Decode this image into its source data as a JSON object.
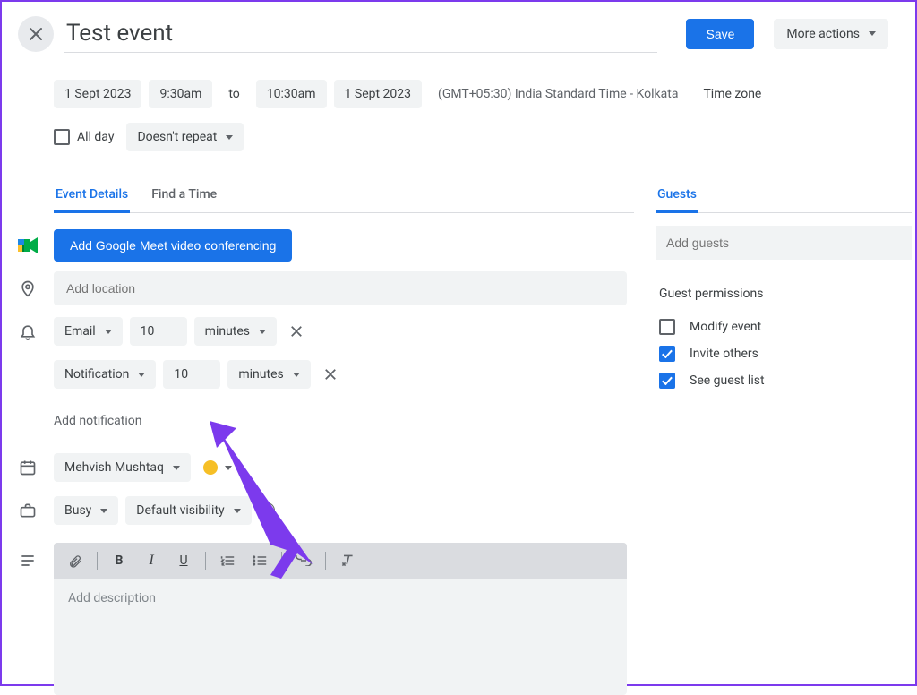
{
  "header": {
    "title": "Test event",
    "save_label": "Save",
    "more_actions_label": "More actions"
  },
  "datetime": {
    "start_date": "1 Sept 2023",
    "start_time": "9:30am",
    "to_label": "to",
    "end_time": "10:30am",
    "end_date": "1 Sept 2023",
    "timezone_text": "(GMT+05:30) India Standard Time - Kolkata",
    "timezone_link": "Time zone"
  },
  "allday": {
    "label": "All day",
    "checked": false,
    "repeat_label": "Doesn't repeat"
  },
  "tabs": {
    "event_details": "Event Details",
    "find_time": "Find a Time"
  },
  "meet_button": "Add Google Meet video conferencing",
  "location": {
    "placeholder": "Add location"
  },
  "notifications": [
    {
      "type": "Email",
      "value": "10",
      "unit": "minutes"
    },
    {
      "type": "Notification",
      "value": "10",
      "unit": "minutes"
    }
  ],
  "add_notification_label": "Add notification",
  "calendar": {
    "owner": "Mehvish Mushtaq",
    "color": "#f6bf26"
  },
  "availability": {
    "status": "Busy",
    "visibility": "Default visibility"
  },
  "description": {
    "placeholder": "Add description"
  },
  "guests": {
    "tab_label": "Guests",
    "placeholder": "Add guests",
    "permissions_title": "Guest permissions",
    "permissions": [
      {
        "label": "Modify event",
        "checked": false
      },
      {
        "label": "Invite others",
        "checked": true
      },
      {
        "label": "See guest list",
        "checked": true
      }
    ]
  }
}
